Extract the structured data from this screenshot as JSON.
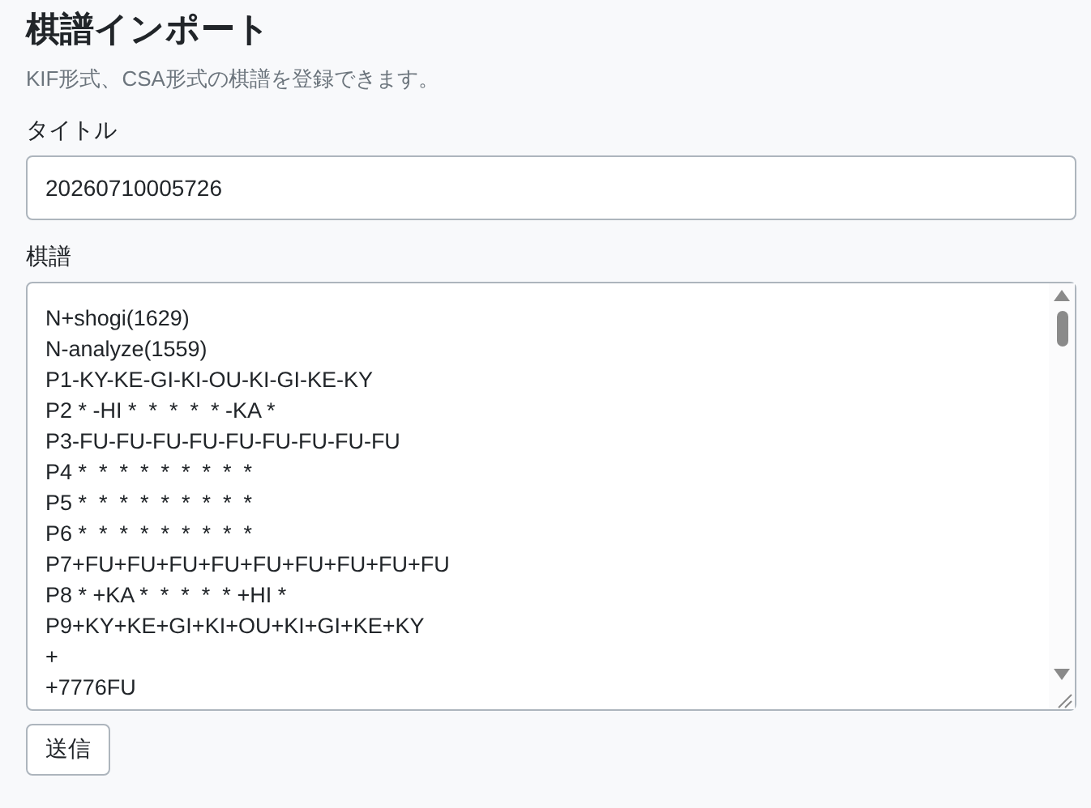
{
  "heading": "棋譜インポート",
  "description": "KIF形式、CSA形式の棋譜を登録できます。",
  "title_field": {
    "label": "タイトル",
    "value": "20260710005726"
  },
  "kifu_field": {
    "label": "棋譜",
    "lines": [
      "N+shogi(1629)",
      "N-analyze(1559)",
      "P1-KY-KE-GI-KI-OU-KI-GI-KE-KY",
      "P2 * -HI *  *  *  *  * -KA *",
      "P3-FU-FU-FU-FU-FU-FU-FU-FU-FU",
      "P4 *  *  *  *  *  *  *  *  *",
      "P5 *  *  *  *  *  *  *  *  *",
      "P6 *  *  *  *  *  *  *  *  *",
      "P7+FU+FU+FU+FU+FU+FU+FU+FU+FU",
      "P8 * +KA *  *  *  *  * +HI *",
      "P9+KY+KE+GI+KI+OU+KI+GI+KE+KY",
      "+",
      "+7776FU"
    ]
  },
  "submit_button": "送信"
}
